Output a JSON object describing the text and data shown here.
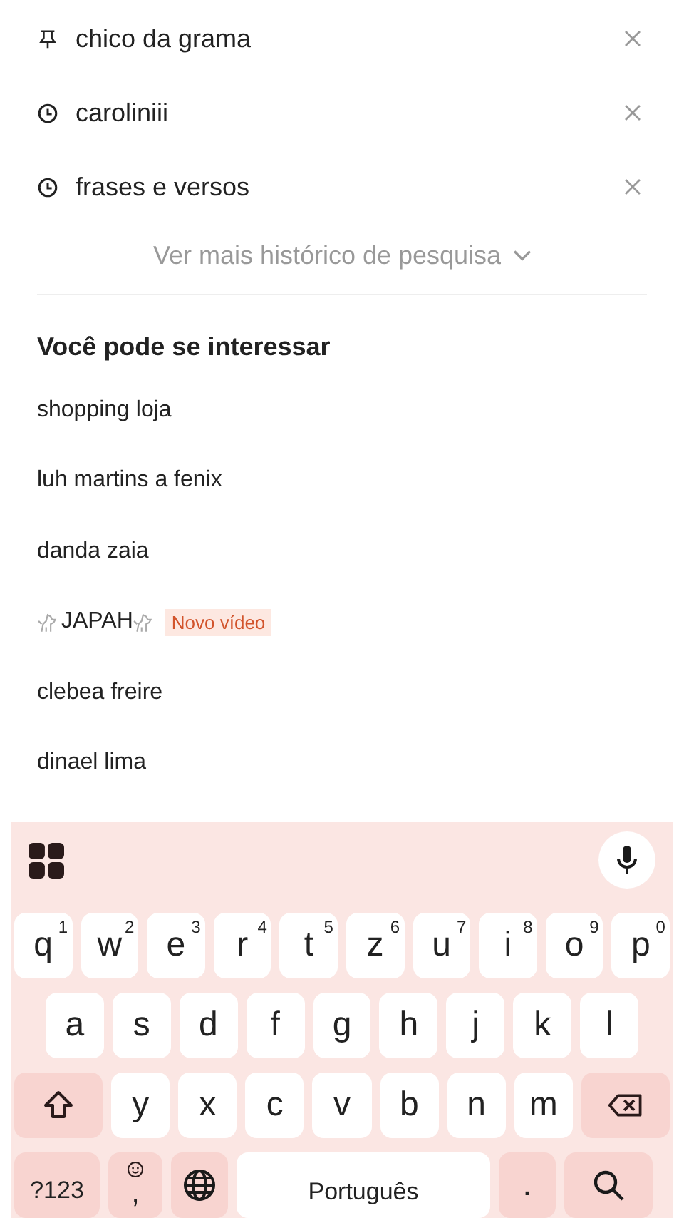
{
  "history": [
    {
      "kind": "pinned",
      "text": "chico da grama"
    },
    {
      "kind": "recent",
      "text": "caroliniii"
    },
    {
      "kind": "recent",
      "text": "frases e versos"
    }
  ],
  "more_history": "Ver mais histórico de pesquisa",
  "suggestions_title": "Você pode se interessar",
  "suggestions": [
    {
      "text": "shopping loja"
    },
    {
      "text": "luh martins a fenix"
    },
    {
      "text": "danda zaia"
    },
    {
      "text": "JAPAH",
      "decorated": true,
      "badge": "Novo vídeo"
    },
    {
      "text": "clebea freire"
    },
    {
      "text": "dinael lima"
    }
  ],
  "keyboard": {
    "row1": [
      {
        "key": "q",
        "hint": "1"
      },
      {
        "key": "w",
        "hint": "2"
      },
      {
        "key": "e",
        "hint": "3"
      },
      {
        "key": "r",
        "hint": "4"
      },
      {
        "key": "t",
        "hint": "5"
      },
      {
        "key": "z",
        "hint": "6"
      },
      {
        "key": "u",
        "hint": "7"
      },
      {
        "key": "i",
        "hint": "8"
      },
      {
        "key": "o",
        "hint": "9"
      },
      {
        "key": "p",
        "hint": "0"
      }
    ],
    "row2": [
      "a",
      "s",
      "d",
      "f",
      "g",
      "h",
      "j",
      "k",
      "l"
    ],
    "row3": [
      "y",
      "x",
      "c",
      "v",
      "b",
      "n",
      "m"
    ],
    "symbols": "?123",
    "comma": ",",
    "space": "Português",
    "period": "."
  }
}
